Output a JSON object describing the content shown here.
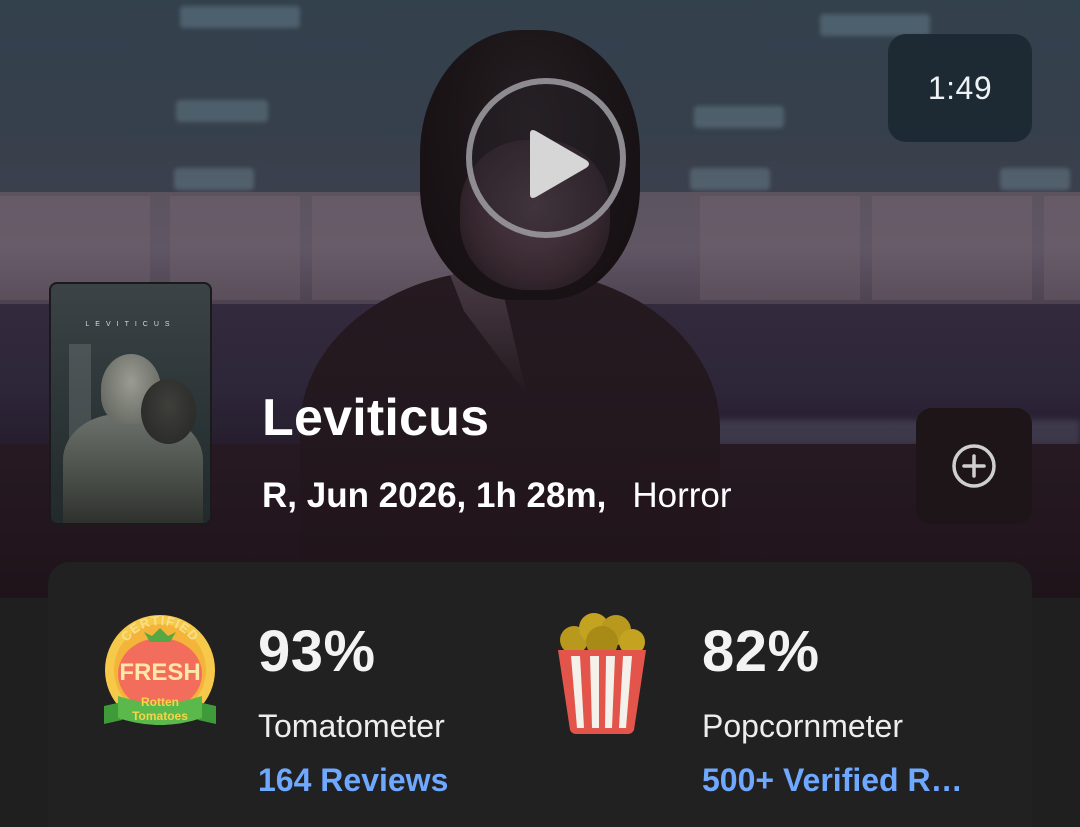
{
  "trailer": {
    "duration": "1:49"
  },
  "poster": {
    "title": "LEVITICUS"
  },
  "movie": {
    "title": "Leviticus",
    "meta": "R, Jun 2026, 1h 28m,",
    "genre": "Horror"
  },
  "scores": {
    "tomatometer": {
      "value": "93%",
      "label": "Tomatometer",
      "reviews": "164 Reviews",
      "badge": {
        "line1": "CERTIFIED",
        "line2": "FRESH",
        "line3": "Rotten",
        "line4": "Tomatoes"
      }
    },
    "popcornmeter": {
      "value": "82%",
      "label": "Popcornmeter",
      "reviews": "500+ Verified R…"
    }
  },
  "colors": {
    "link": "#6fa8ff",
    "card_bg": "#212121",
    "badge_bg": "#1e2a33"
  },
  "icons": {
    "play": "play-icon",
    "add": "plus-circle-icon",
    "tomato": "certified-fresh-icon",
    "popcorn": "popcorn-bucket-icon"
  }
}
